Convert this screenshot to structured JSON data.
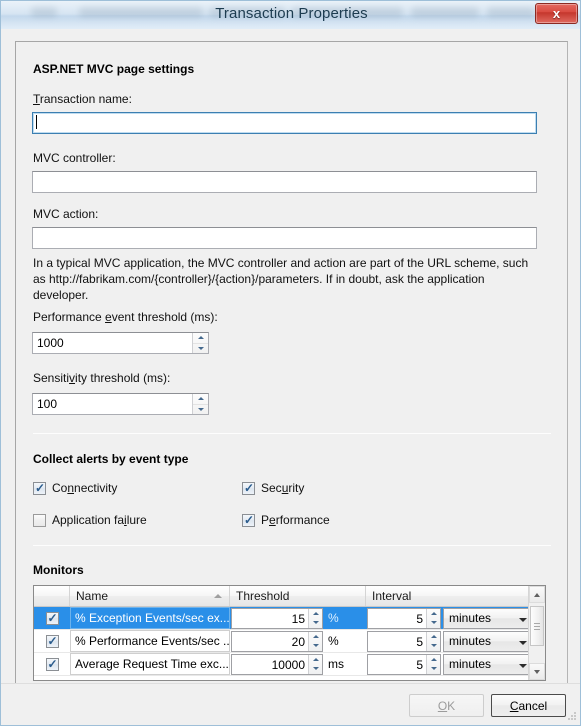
{
  "window": {
    "title": "Transaction Properties",
    "close_label": "x"
  },
  "section_page_settings": {
    "heading": "ASP.NET MVC page settings",
    "fields": [
      {
        "label": "Transaction name:",
        "value": "",
        "focused": true
      },
      {
        "label": "MVC controller:",
        "value": "",
        "focused": false
      },
      {
        "label": "MVC action:",
        "value": "",
        "focused": false
      }
    ],
    "help_text": "In a typical MVC application, the MVC controller and action are part of the URL scheme, such as http://fabrikam.com/{controller}/{action}/parameters. If in doubt, ask the application developer.",
    "performance_threshold_label": "Performance event threshold (ms):",
    "performance_threshold_value": "1000",
    "sensitivity_threshold_label": "Sensitivity threshold (ms):",
    "sensitivity_threshold_value": "100"
  },
  "section_alerts": {
    "heading": "Collect alerts by event type",
    "checkboxes": [
      {
        "label": "Connectivity",
        "checked": true
      },
      {
        "label": "Security",
        "checked": true
      },
      {
        "label": "Application failure",
        "checked": false
      },
      {
        "label": "Performance",
        "checked": true
      }
    ]
  },
  "section_monitors": {
    "heading": "Monitors",
    "columns": [
      "",
      "Name",
      "Threshold",
      "Interval"
    ],
    "sort_column": "Name",
    "sort_direction": "ascending",
    "rows": [
      {
        "enabled": true,
        "name": "% Exception Events/sec ex...",
        "threshold": "15",
        "threshold_unit": "%",
        "interval": "5",
        "interval_unit": "minutes",
        "selected": true
      },
      {
        "enabled": true,
        "name": "% Performance Events/sec ...",
        "threshold": "20",
        "threshold_unit": "%",
        "interval": "5",
        "interval_unit": "minutes",
        "selected": false
      },
      {
        "enabled": true,
        "name": "Average Request Time exc...",
        "threshold": "10000",
        "threshold_unit": "ms",
        "interval": "5",
        "interval_unit": "minutes",
        "selected": false
      }
    ]
  },
  "footer": {
    "ok_label": "OK",
    "ok_enabled": false,
    "cancel_label": "Cancel",
    "cancel_enabled": true
  },
  "colors": {
    "selection_blue": "#2a8fe8",
    "close_red": "#d94b41",
    "titlebar_blue": "#cfe0f0",
    "panel_gray": "#f0f0f0"
  }
}
